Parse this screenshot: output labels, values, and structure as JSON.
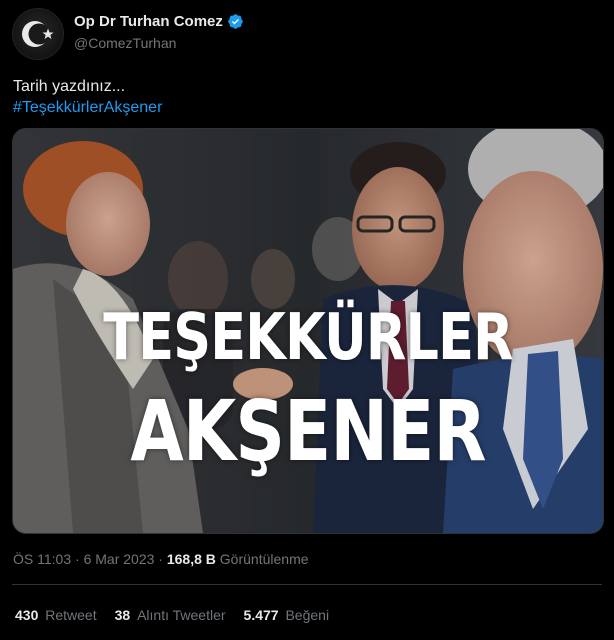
{
  "author": {
    "display_name": "Op Dr Turhan Comez",
    "handle": "@ComezTurhan",
    "avatar_icon": "turkish-flag-crescent-star-icon",
    "verified_icon": "verified-badge-icon"
  },
  "tweet": {
    "text_line1": "Tarih yazdınız...",
    "hashtag": "#TeşekkürlerAkşener"
  },
  "media": {
    "overlay_line1": "TEŞEKKÜRLER",
    "overlay_line2": "AKŞENER"
  },
  "meta": {
    "time": "ÖS 11:03",
    "date": "6 Mar 2023",
    "views_count": "168,8 B",
    "views_label": "Görüntülenme"
  },
  "stats": {
    "retweets_count": "430",
    "retweets_label": "Retweet",
    "quotes_count": "38",
    "quotes_label": "Alıntı Tweetler",
    "likes_count": "5.477",
    "likes_label": "Beğeni"
  },
  "colors": {
    "background": "#000000",
    "text": "#e7e9ea",
    "secondary": "#71767b",
    "link": "#1d9bf0"
  }
}
